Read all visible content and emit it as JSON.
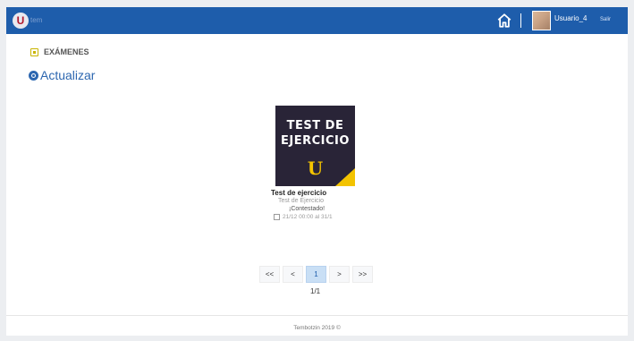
{
  "header": {
    "logo_letter": "U",
    "logo_text": "tem",
    "username": "Usuario_4",
    "logout_label": "Salir"
  },
  "section": {
    "title": "EXÁMENES",
    "refresh_label": "Actualizar"
  },
  "exam": {
    "thumb_title_line1": "TEST DE",
    "thumb_title_line2": "EJERCICIO",
    "thumb_letter": "U",
    "title": "Test de ejercicio",
    "subtitle": "Test de Ejercicio",
    "status": "¡Contestado!",
    "date": "21/12 00:00 al 31/1"
  },
  "pagination": {
    "first": "<<",
    "prev": "<",
    "current": "1",
    "next": ">",
    "last": ">>",
    "info": "1/1"
  },
  "footer": {
    "text": "Tembotzin 2019 ©"
  },
  "colors": {
    "topbar": "#1e5dab",
    "accent": "#2d67b0",
    "thumb_bg": "#292437",
    "thumb_accent": "#f3c300"
  }
}
